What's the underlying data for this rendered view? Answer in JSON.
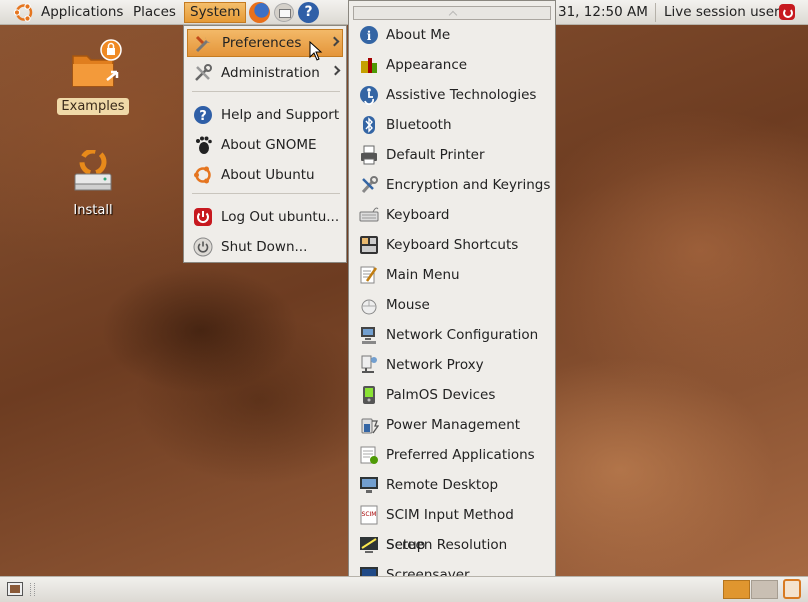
{
  "top_panel": {
    "applications_label": "Applications",
    "places_label": "Places",
    "system_label": "System",
    "clock_text": "31, 12:50 AM",
    "user_label": "Live session user"
  },
  "desktop_icons": [
    {
      "label": "Examples"
    },
    {
      "label": "Install"
    }
  ],
  "system_menu": {
    "items": [
      {
        "label": "Preferences",
        "icon": "preferences-icon"
      },
      {
        "label": "Administration",
        "icon": "administration-icon"
      },
      {
        "label": "Help and Support",
        "icon": "help-icon"
      },
      {
        "label": "About GNOME",
        "icon": "gnome-foot-icon"
      },
      {
        "label": "About Ubuntu",
        "icon": "ubuntu-logo-icon"
      },
      {
        "label": "Log Out ubuntu...",
        "icon": "logout-icon"
      },
      {
        "label": "Shut Down...",
        "icon": "power-icon"
      }
    ]
  },
  "preferences_menu": {
    "items": [
      {
        "label": "About Me",
        "icon": "about-me-icon"
      },
      {
        "label": "Appearance",
        "icon": "appearance-icon"
      },
      {
        "label": "Assistive Technologies",
        "icon": "accessibility-icon"
      },
      {
        "label": "Bluetooth",
        "icon": "bluetooth-icon"
      },
      {
        "label": "Default Printer",
        "icon": "printer-icon"
      },
      {
        "label": "Encryption and Keyrings",
        "icon": "keyrings-icon"
      },
      {
        "label": "Keyboard",
        "icon": "keyboard-icon"
      },
      {
        "label": "Keyboard Shortcuts",
        "icon": "keyboard-shortcuts-icon"
      },
      {
        "label": "Main Menu",
        "icon": "main-menu-icon"
      },
      {
        "label": "Mouse",
        "icon": "mouse-icon"
      },
      {
        "label": "Network Configuration",
        "icon": "network-config-icon"
      },
      {
        "label": "Network Proxy",
        "icon": "network-proxy-icon"
      },
      {
        "label": "PalmOS Devices",
        "icon": "palm-device-icon"
      },
      {
        "label": "Power Management",
        "icon": "power-management-icon"
      },
      {
        "label": "Preferred Applications",
        "icon": "preferred-apps-icon"
      },
      {
        "label": "Remote Desktop",
        "icon": "remote-desktop-icon"
      },
      {
        "label": "SCIM Input Method Setup",
        "icon": "scim-icon"
      },
      {
        "label": "Screen Resolution",
        "icon": "screen-resolution-icon"
      },
      {
        "label": "Screensaver",
        "icon": "screensaver-icon"
      }
    ]
  },
  "colors": {
    "accent": "#e69a35",
    "menu_bg": "#efede9",
    "panel_bg": "#dcd9d3"
  }
}
